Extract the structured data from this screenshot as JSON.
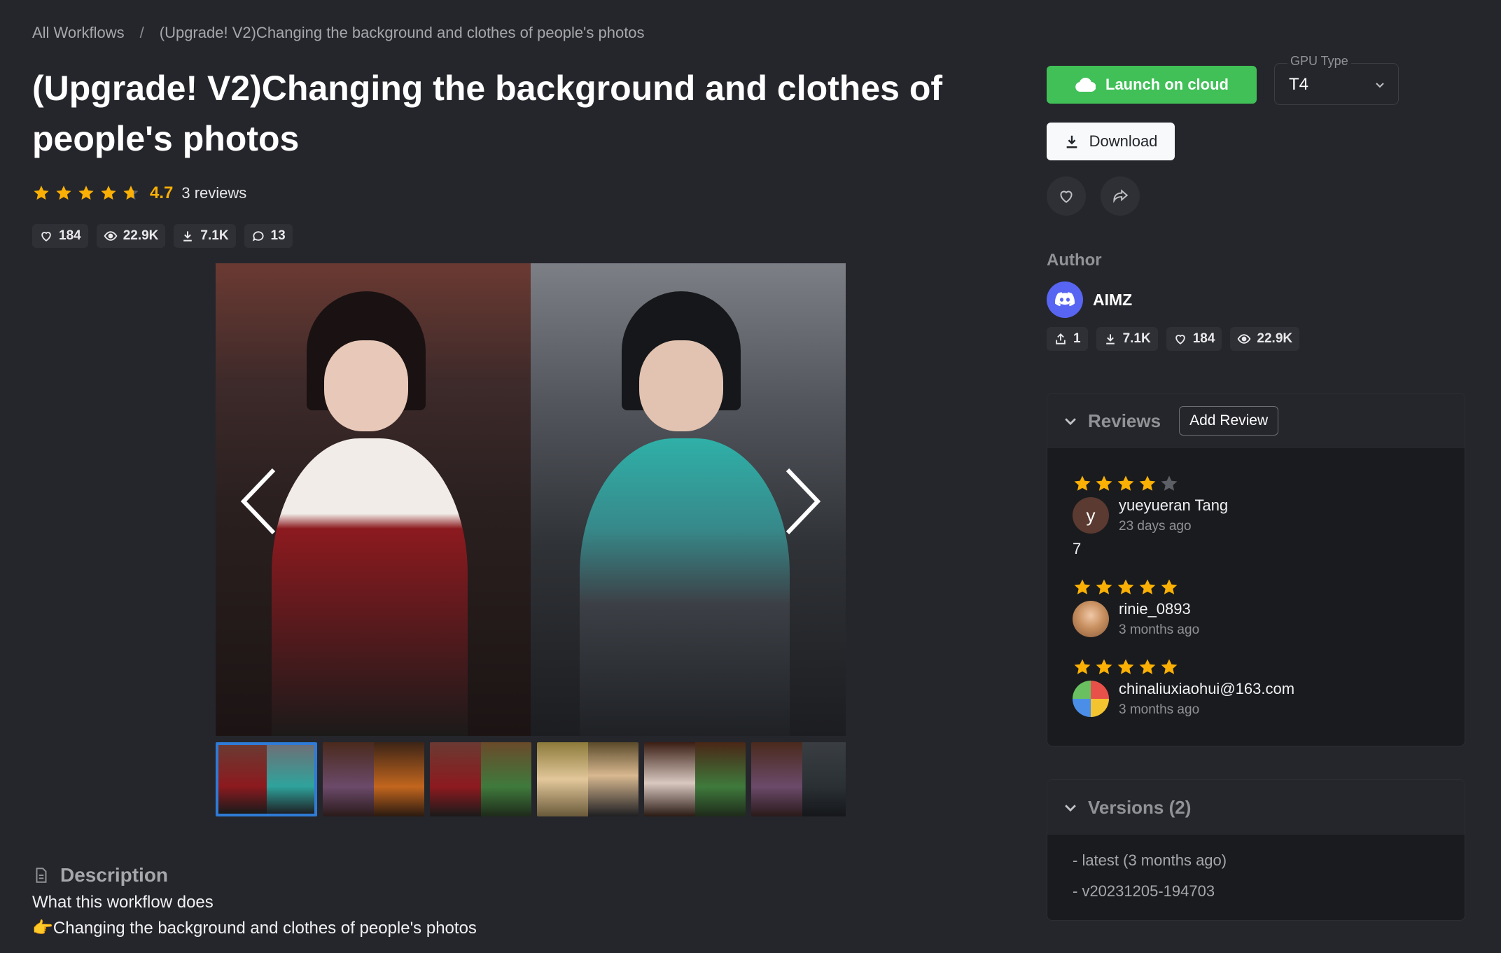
{
  "breadcrumb": {
    "root": "All Workflows",
    "separator": "/",
    "current": "(Upgrade! V2)Changing the background and clothes of people's photos"
  },
  "title": "(Upgrade! V2)Changing the background and clothes of people's photos",
  "rating": {
    "value": "4.7",
    "reviews_label": "3 reviews",
    "stars": 4.7,
    "star_color": "#fab005"
  },
  "stats": {
    "likes": "184",
    "views": "22.9K",
    "downloads": "7.1K",
    "comments": "13"
  },
  "gallery": {
    "thumbnail_count": 6,
    "active_thumbnail": 1
  },
  "description": {
    "heading": "Description",
    "line1": "What this workflow does",
    "line2": "👉Changing the background and clothes of people's photos"
  },
  "actions": {
    "launch_label": "Launch on cloud",
    "launch_color": "#40c057",
    "gpu_label": "GPU Type",
    "gpu_value": "T4",
    "download_label": "Download"
  },
  "author": {
    "label": "Author",
    "name": "AIMZ",
    "stats": {
      "uploads": "1",
      "downloads": "7.1K",
      "likes": "184",
      "views": "22.9K"
    }
  },
  "reviews": {
    "title": "Reviews",
    "add_label": "Add Review",
    "items": [
      {
        "stars": 4,
        "initial": "y",
        "name": "yueyueran Tang",
        "date": "23 days ago",
        "text": "7"
      },
      {
        "stars": 5,
        "initial": "",
        "name": "rinie_0893",
        "date": "3 months ago",
        "text": ""
      },
      {
        "stars": 5,
        "initial": "",
        "name": "chinaliuxiaohui@163.com",
        "date": "3 months ago",
        "text": ""
      }
    ]
  },
  "versions": {
    "title": "Versions (2)",
    "items": [
      "- latest (3 months ago)",
      "- v20231205-194703"
    ]
  }
}
